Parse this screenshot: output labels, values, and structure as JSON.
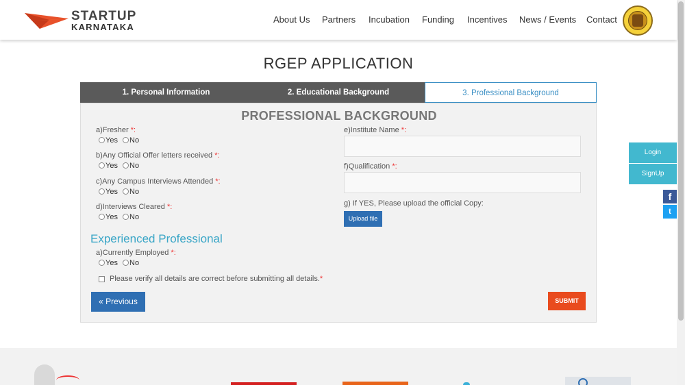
{
  "brand": {
    "line1": "STARTUP",
    "line2": "KARNATAKA",
    "accent": "#e8512a"
  },
  "nav": {
    "items": [
      {
        "label": "About Us"
      },
      {
        "label": "Partners"
      },
      {
        "label": "Incubation"
      },
      {
        "label": "Funding"
      },
      {
        "label": "Incentives"
      },
      {
        "label": "News / Events"
      },
      {
        "label": "Contact"
      }
    ],
    "emblem_icon": "government-of-karnataka-emblem"
  },
  "page": {
    "title": "RGEP APPLICATION"
  },
  "tabs": [
    {
      "label": "1. Personal Information",
      "state": "completed"
    },
    {
      "label": "2. Educational Background",
      "state": "completed"
    },
    {
      "label": "3. Professional Background",
      "state": "active"
    }
  ],
  "form": {
    "section_title": "PROFESSIONAL BACKGROUND",
    "required_mark": "*:",
    "left_questions": [
      {
        "label": "a)Fresher",
        "options": [
          "Yes",
          "No"
        ]
      },
      {
        "label": "b)Any Official Offer letters received",
        "options": [
          "Yes",
          "No"
        ]
      },
      {
        "label": "c)Any Campus Interviews Attended",
        "options": [
          "Yes",
          "No"
        ]
      },
      {
        "label": "d)Interviews Cleared",
        "options": [
          "Yes",
          "No"
        ]
      }
    ],
    "institute_name": {
      "label": "e)Institute Name",
      "value": ""
    },
    "qualification": {
      "label": "f)Qualification",
      "value": ""
    },
    "upload": {
      "label": "g) If YES, Please upload the official Copy:",
      "button": "Upload file"
    },
    "experienced": {
      "title": "Experienced Professional",
      "question": {
        "label": "a)Currently Employed",
        "options": [
          "Yes",
          "No"
        ]
      }
    },
    "verify": {
      "label": "Please verify all details are correct before submitting all details.",
      "mark": "*"
    },
    "previous_button": "« Previous",
    "submit_button": "SUBMIT"
  },
  "side": {
    "login": "Login",
    "signup": "SignUp",
    "facebook": "f",
    "twitter": "t"
  },
  "colors": {
    "tab_dark": "#5a5a5a",
    "tab_active": "#3a8fc4",
    "blue_button": "#2f6fb3",
    "submit": "#e94b1e",
    "teal": "#42b8cf"
  }
}
